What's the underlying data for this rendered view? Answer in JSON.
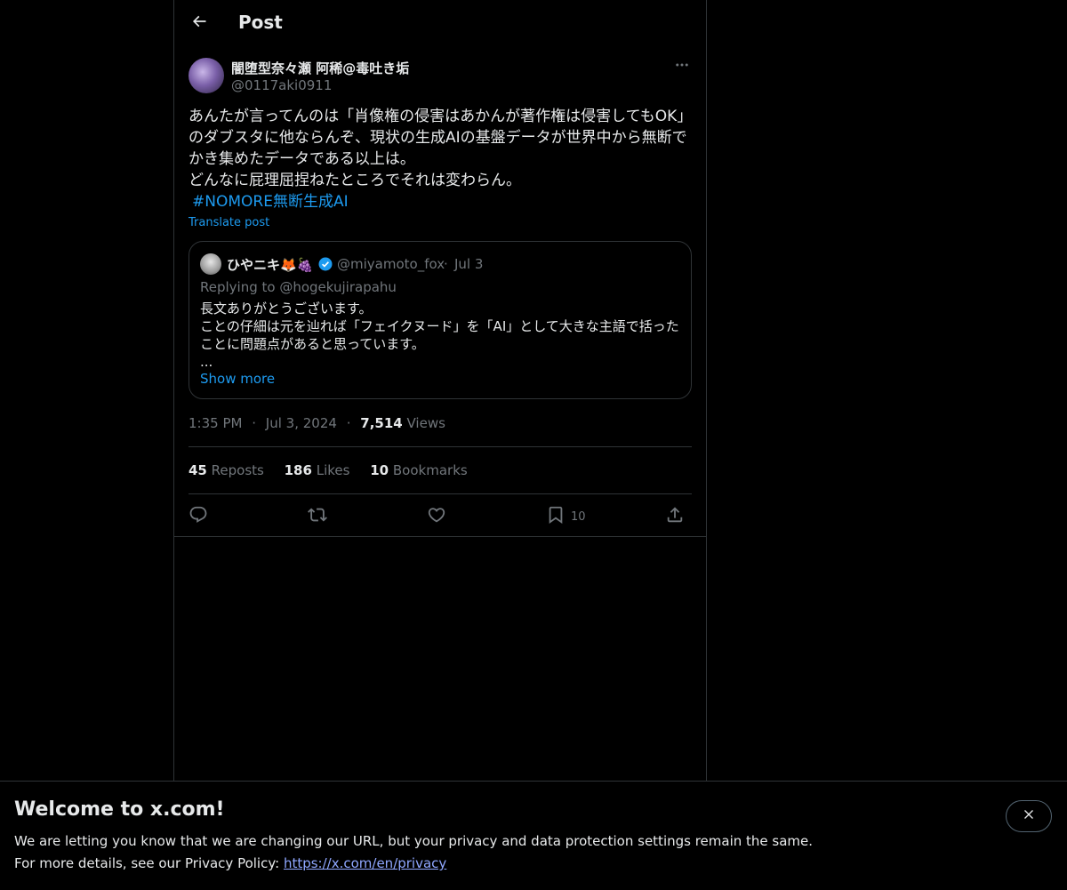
{
  "header": {
    "title": "Post",
    "back_icon": "arrow-left-icon"
  },
  "post": {
    "author_name": "闇堕型奈々瀬 阿稀@毒吐き垢",
    "author_handle": "@0117aki0911",
    "text_lines": [
      "あんたが言ってんのは「肖像権の侵害はあかんが著作権は侵害してもOK」",
      "のダブスタに他ならんぞ、現状の生成AIの基盤データが世界中から無断で",
      "かき集めたデータである以上は。",
      "どんなに屁理屈捏ねたところでそれは変わらん。"
    ],
    "hashtag": "#NOMORE無断生成AI",
    "translate_label": "Translate post",
    "time": "1:35 PM",
    "date": "Jul 3, 2024",
    "views_count": "7,514",
    "views_label": "Views",
    "separator": "·"
  },
  "quote": {
    "name": "ひやニキ🦊🍇",
    "handle": "@miyamoto_fox",
    "dot": "·",
    "date": "Jul 3",
    "verified": true,
    "replying_to": "Replying to @hogekujirapahu",
    "text_lines": [
      "長文ありがとうございます。",
      "ことの仔細は元を辿れば「フェイクヌード」を「AI」として大きな主語で括った",
      "ことに問題点があると思っています。",
      "..."
    ],
    "show_more": "Show more"
  },
  "stats": {
    "reposts_count": "45",
    "reposts_label": "Reposts",
    "likes_count": "186",
    "likes_label": "Likes",
    "bookmarks_count": "10",
    "bookmarks_label": "Bookmarks"
  },
  "actions": {
    "reply_icon": "reply-icon",
    "repost_icon": "repost-icon",
    "like_icon": "like-icon",
    "bookmark_icon": "bookmark-icon",
    "bookmark_count": "10",
    "share_icon": "share-icon"
  },
  "banner": {
    "title": "Welcome to x.com!",
    "line1": "We are letting you know that we are changing our URL, but your privacy and data protection settings remain the same.",
    "line2_prefix": "For more details, see our Privacy Policy: ",
    "link": "https://x.com/en/privacy"
  },
  "colors": {
    "background": "#000000",
    "text": "#e7e9ea",
    "muted": "#71767b",
    "accent": "#1d9bf0",
    "border": "#2f3336"
  }
}
